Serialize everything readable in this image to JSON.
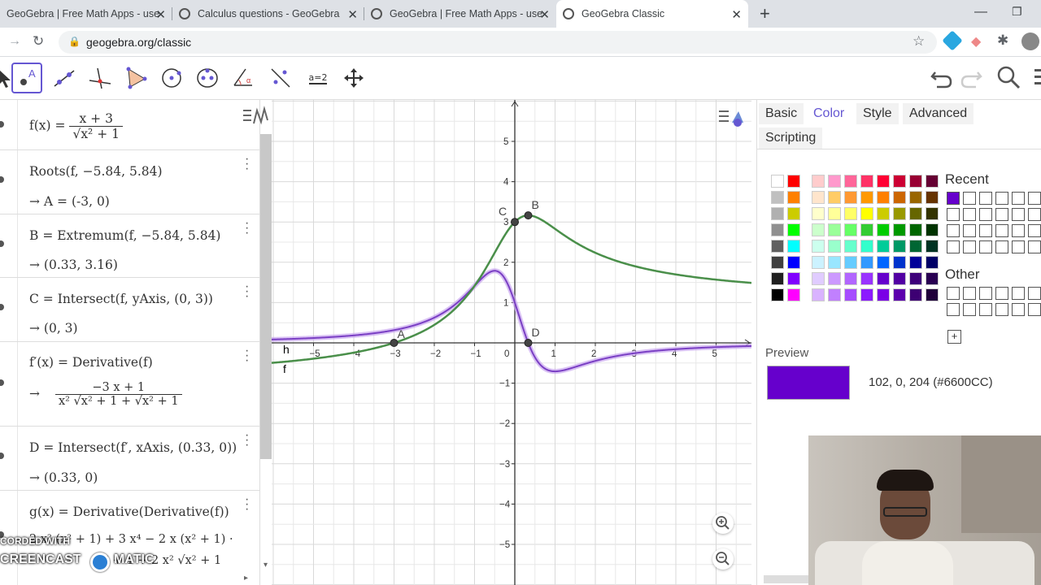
{
  "browser": {
    "tabs": [
      {
        "label": "GeoGebra | Free Math Apps - use",
        "active": false
      },
      {
        "label": "Calculus questions - GeoGebra",
        "active": false
      },
      {
        "label": "GeoGebra | Free Math Apps - use",
        "active": false
      },
      {
        "label": "GeoGebra Classic",
        "active": true
      }
    ],
    "url": "geogebra.org/classic",
    "new_tab": "+"
  },
  "toolbar": {
    "tools": [
      "move-tool",
      "point-tool",
      "line-tool",
      "perpendicular-tool",
      "polygon-tool",
      "circle-tool",
      "ellipse-tool",
      "angle-tool",
      "reflect-tool",
      "slider-tool",
      "move-graphics-tool"
    ],
    "slider_label": "a=2"
  },
  "algebra": {
    "rows": [
      {
        "line1": "f(x) =",
        "num": "x + 3",
        "den": "√x² + 1"
      },
      {
        "line1": "Roots(f, −5.84, 5.84)",
        "line2": "→  A = (-3, 0)"
      },
      {
        "line1": "B = Extremum(f, −5.84, 5.84)",
        "line2": "→  (0.33, 3.16)"
      },
      {
        "line1": "C = Intersect(f, yAxis, (0, 3))",
        "line2": "→  (0, 3)"
      },
      {
        "line1": "f′(x) = Derivative(f)",
        "arrow": "→",
        "num": "−3 x + 1",
        "den": "x² √x² + 1 + √x² + 1"
      },
      {
        "line1": "D = Intersect(f′, xAxis, (0.33, 0))",
        "line2": "→  (0.33, 0)"
      },
      {
        "line1": "g(x) = Derivative(Derivative(f))",
        "line2": "2 x² (x² + 1) + 3 x⁴ − 2 x (x² + 1) ·",
        "line3": "x² + 1 + 2 x² √x² + 1"
      }
    ],
    "watermark1": "CORDED WITH",
    "watermark2": "CREENCAST",
    "watermark3": "MATIC"
  },
  "graphics": {
    "x_ticks": [
      "−5",
      "−4",
      "−3",
      "−2",
      "−1",
      "0",
      "1",
      "2",
      "3",
      "4",
      "5"
    ],
    "y_ticks": [
      "5",
      "4",
      "3",
      "2",
      "1",
      "−1",
      "−2",
      "−3",
      "−4",
      "−5"
    ],
    "labels": {
      "A": "A",
      "B": "B",
      "C": "C",
      "D": "D",
      "f": "f",
      "h": "h"
    },
    "colors": {
      "f": "#4a8f4a",
      "h": "#7a3fc4",
      "grid": "#e8e8e8",
      "axis": "#333333"
    }
  },
  "properties": {
    "tabs": [
      "Basic",
      "Color",
      "Style",
      "Advanced",
      "Scripting"
    ],
    "active_tab": "Color",
    "recent_label": "Recent",
    "other_label": "Other",
    "preview_label": "Preview",
    "preview_color": "#6600CC",
    "preview_value": "102, 0, 204 (#6600CC)",
    "add_button": "+"
  }
}
